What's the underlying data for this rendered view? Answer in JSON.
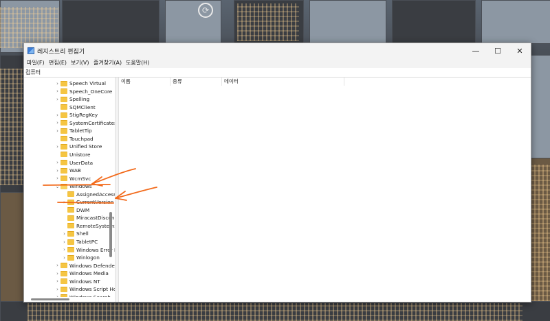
{
  "window": {
    "title": "레지스트리 편집기",
    "controls": {
      "minimize_icon": "minimize-icon",
      "maximize_icon": "maximize-icon",
      "close_icon": "close-icon"
    }
  },
  "menu": [
    "파일(F)",
    "편집(E)",
    "보기(V)",
    "즐겨찾기(A)",
    "도움말(H)"
  ],
  "address": "컴퓨터",
  "tree": [
    {
      "label": "Speech Virtual",
      "expander": "collapsed",
      "depth": 0
    },
    {
      "label": "Speech_OneCore",
      "expander": "collapsed",
      "depth": 0
    },
    {
      "label": "Spelling",
      "expander": "collapsed",
      "depth": 0
    },
    {
      "label": "SQMClient",
      "expander": "none",
      "depth": 0
    },
    {
      "label": "StigRegKey",
      "expander": "collapsed",
      "depth": 0
    },
    {
      "label": "SystemCertificates",
      "expander": "collapsed",
      "depth": 0
    },
    {
      "label": "TabletTip",
      "expander": "collapsed",
      "depth": 0
    },
    {
      "label": "Touchpad",
      "expander": "none",
      "depth": 0
    },
    {
      "label": "Unified Store",
      "expander": "collapsed",
      "depth": 0
    },
    {
      "label": "Unistore",
      "expander": "none",
      "depth": 0
    },
    {
      "label": "UserData",
      "expander": "collapsed",
      "depth": 0
    },
    {
      "label": "WAB",
      "expander": "collapsed",
      "depth": 0
    },
    {
      "label": "WcmSvc",
      "expander": "collapsed",
      "depth": 0
    },
    {
      "label": "Windows",
      "expander": "expanded",
      "depth": 0
    },
    {
      "label": "AssignedAccessConfiguration",
      "expander": "none",
      "depth": 1
    },
    {
      "label": "CurrentVersion",
      "expander": "collapsed",
      "depth": 1
    },
    {
      "label": "DWM",
      "expander": "none",
      "depth": 1
    },
    {
      "label": "MiracastDisconnect",
      "expander": "none",
      "depth": 1
    },
    {
      "label": "RemoteSystems",
      "expander": "none",
      "depth": 1
    },
    {
      "label": "Shell",
      "expander": "collapsed",
      "depth": 1
    },
    {
      "label": "TabletPC",
      "expander": "collapsed",
      "depth": 1
    },
    {
      "label": "Windows Error Reporting",
      "expander": "collapsed",
      "depth": 1
    },
    {
      "label": "Winlogon",
      "expander": "collapsed",
      "depth": 1
    },
    {
      "label": "Windows Defender",
      "expander": "collapsed",
      "depth": 0
    },
    {
      "label": "Windows Media",
      "expander": "collapsed",
      "depth": 0
    },
    {
      "label": "Windows NT",
      "expander": "collapsed",
      "depth": 0
    },
    {
      "label": "Windows Script Host",
      "expander": "collapsed",
      "depth": 0
    },
    {
      "label": "Windows Search",
      "expander": "collapsed",
      "depth": 0
    }
  ],
  "list": {
    "columns": [
      "이름",
      "종류",
      "데이터"
    ]
  },
  "desktop": {
    "icon": "user-circle-icon"
  },
  "colors": {
    "annotation": "#f26a1b",
    "folder": "#f5c543",
    "window_chrome": "#f3f3f3"
  }
}
